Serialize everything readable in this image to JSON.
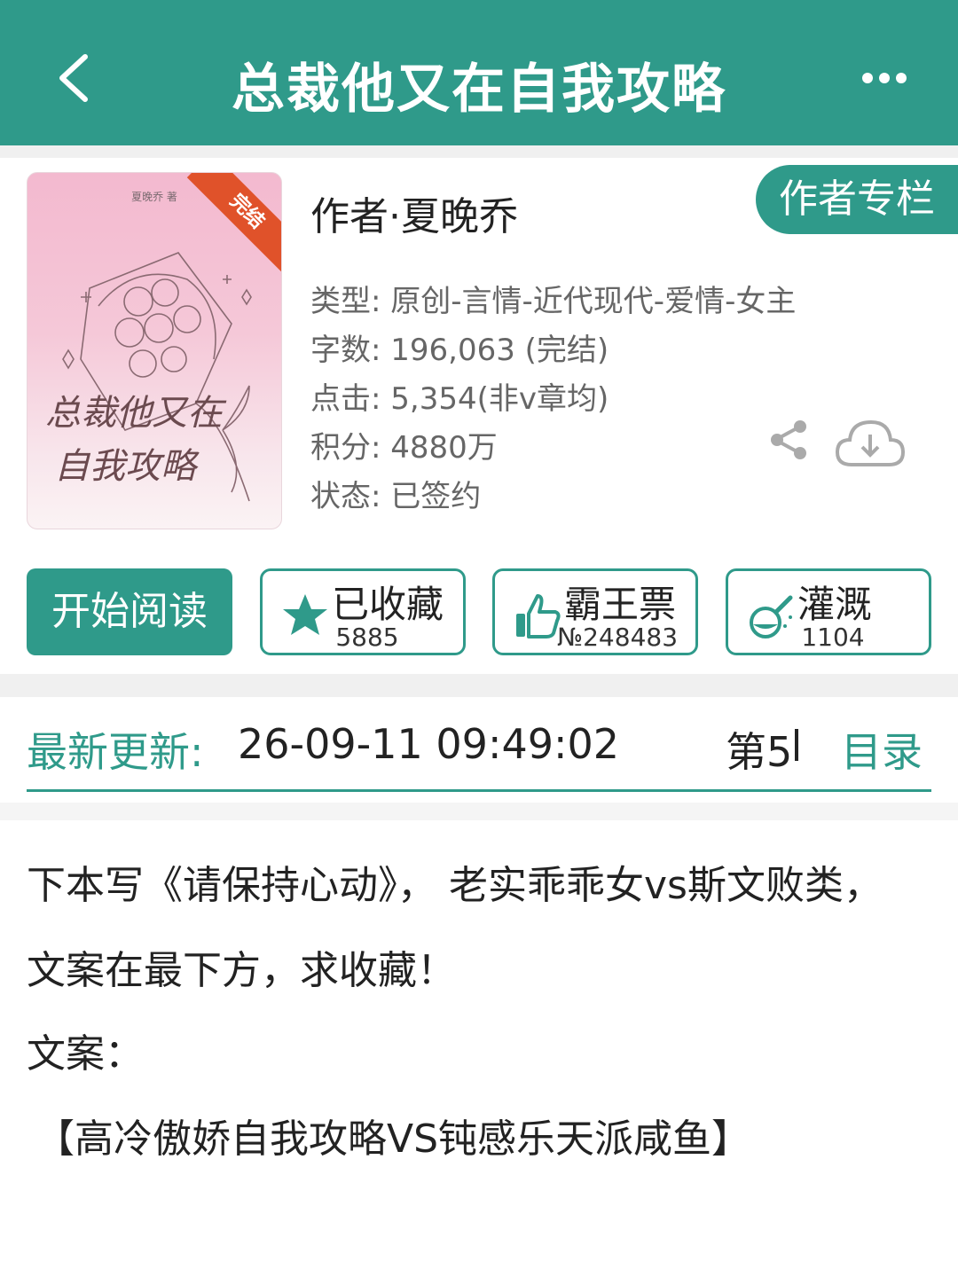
{
  "header": {
    "title": "总裁他又在自我攻略"
  },
  "book": {
    "cover_byline": "夏晚乔 著",
    "cover_ribbon": "完结",
    "cover_title_line1": "总裁他又在",
    "cover_title_line2": "自我攻略",
    "author": "作者·夏晚乔",
    "author_column_button": "作者专栏",
    "meta": [
      {
        "label": "类型: ",
        "value": "原创-言情-近代现代-爱情-女主"
      },
      {
        "label": "字数: ",
        "value": "196,063 (完结)"
      },
      {
        "label": "点击: ",
        "value": "5,354(非v章均)"
      },
      {
        "label": "积分: ",
        "value": "4880万"
      },
      {
        "label": "状态: ",
        "value": "已签约"
      }
    ]
  },
  "actions": {
    "read": "开始阅读",
    "collect": {
      "label": "已收藏",
      "count": "5885"
    },
    "vote": {
      "label": "霸王票",
      "count": "№248483"
    },
    "water": {
      "label": "灌溉",
      "count": "1104"
    }
  },
  "update": {
    "label": "最新更新:",
    "time": "26-09-11 09:49:02",
    "chapter": "第5",
    "toc": "目录"
  },
  "description": [
    "下本写《请保持心动》， 老实乖乖女vs斯文败类，",
    "文案在最下方，求收藏！",
    "文案：",
    "【高冷傲娇自我攻略VS钝感乐天派咸鱼】"
  ],
  "colors": {
    "primary": "#2f9a8a",
    "ribbon": "#e0522a",
    "divider": "#f0f0f0"
  },
  "icons": [
    "back-icon",
    "more-icon",
    "share-icon",
    "download-cloud-icon",
    "star-icon",
    "thumbs-up-icon",
    "watering-icon"
  ]
}
